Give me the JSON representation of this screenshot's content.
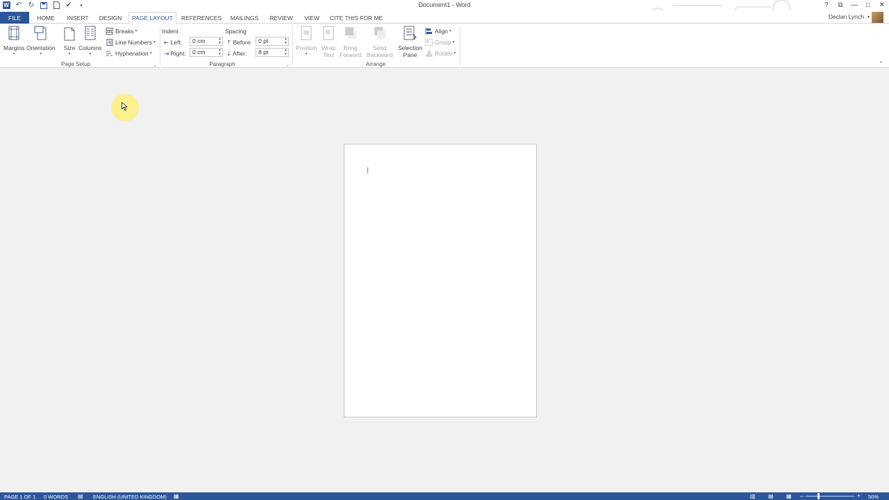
{
  "title_bar": {
    "document_title": "Document1 - Word",
    "quick_access": [
      "word-logo",
      "undo-icon",
      "redo-icon",
      "save-icon",
      "new-document-icon",
      "spelling-check-icon",
      "customize-qat-icon"
    ],
    "window_controls": [
      "?",
      "⧉",
      "—",
      "□",
      "✕"
    ]
  },
  "tabs": [
    {
      "label": "FILE"
    },
    {
      "label": "HOME"
    },
    {
      "label": "INSERT"
    },
    {
      "label": "DESIGN"
    },
    {
      "label": "PAGE LAYOUT",
      "active": true
    },
    {
      "label": "REFERENCES"
    },
    {
      "label": "MAILINGS"
    },
    {
      "label": "REVIEW"
    },
    {
      "label": "VIEW"
    },
    {
      "label": "CITE THIS FOR ME"
    }
  ],
  "user": {
    "name": "Declan Lynch"
  },
  "ribbon": {
    "page_setup": {
      "label": "Page Setup",
      "margins": "Margins",
      "orientation": "Orientation",
      "size": "Size",
      "columns": "Columns",
      "breaks": "Breaks",
      "line_numbers": "Line Numbers",
      "hyphenation": "Hyphenation"
    },
    "paragraph": {
      "label": "Paragraph",
      "indent_heading": "Indent",
      "left_label": "Left:",
      "left_value": "0 cm",
      "right_label": "Right:",
      "right_value": "0 cm",
      "spacing_heading": "Spacing",
      "before_label": "Before:",
      "before_value": "0 pt",
      "after_label": "After:",
      "after_value": "8 pt"
    },
    "arrange": {
      "label": "Arrange",
      "position": "Position",
      "wrap_text_1": "Wrap",
      "wrap_text_2": "Text",
      "bring_forward_1": "Bring",
      "bring_forward_2": "Forward",
      "send_backward_1": "Send",
      "send_backward_2": "Backward",
      "selection_pane_1": "Selection",
      "selection_pane_2": "Pane",
      "align": "Align",
      "group": "Group",
      "rotate": "Rotate"
    }
  },
  "status_bar": {
    "page": "PAGE 1 OF 1",
    "words": "0 WORDS",
    "language": "ENGLISH (UNITED KINGDOM)",
    "zoom": "50%",
    "zoom_minus": "–",
    "zoom_plus": "+"
  },
  "colors": {
    "accent": "#2b579a",
    "ribbon_bg": "#ffffff",
    "doc_bg": "#f1f1f1"
  }
}
